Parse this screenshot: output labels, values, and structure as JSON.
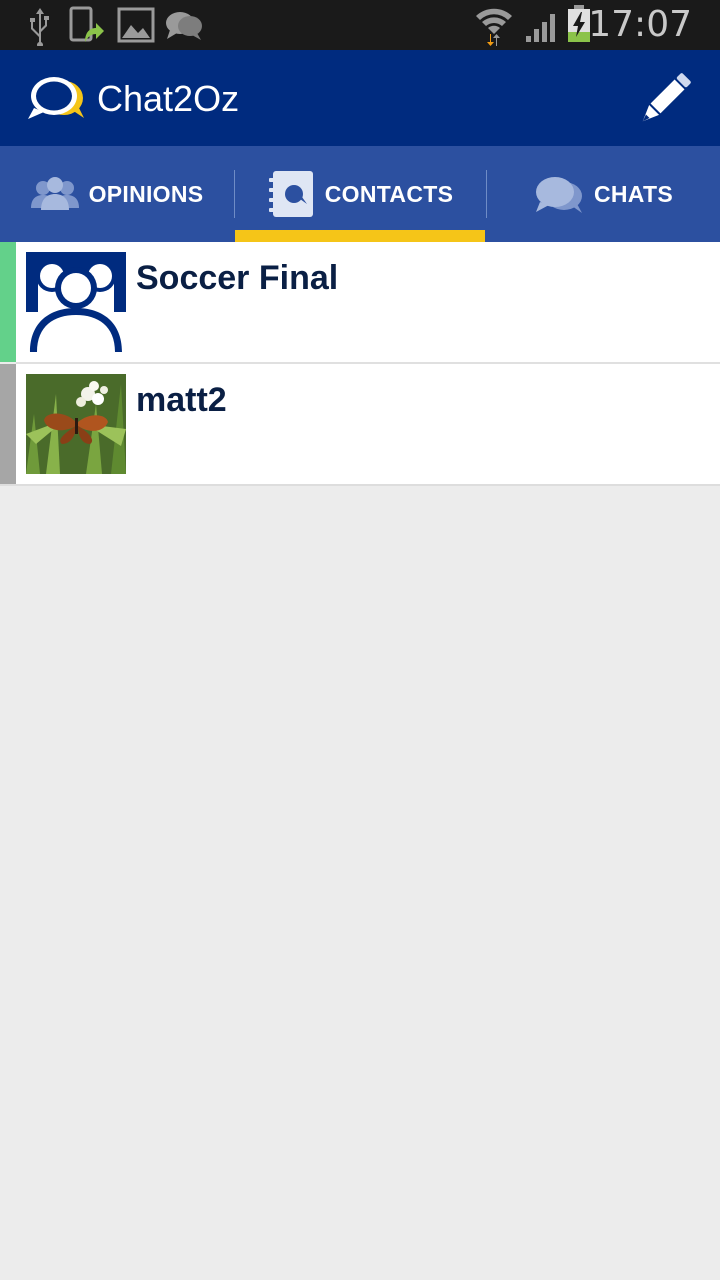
{
  "status_bar": {
    "time": "17:07",
    "icons": [
      "usb-icon",
      "phone-update-icon",
      "gallery-icon",
      "chat-notification-icon",
      "wifi-icon",
      "signal-icon",
      "battery-charging-icon"
    ],
    "battery_color": "#8bc34a"
  },
  "app_bar": {
    "title": "Chat2Oz",
    "logo_icon": "speech-bubbles-icon",
    "action_icon": "pencil-icon"
  },
  "tabs": [
    {
      "label": "OPINIONS",
      "icon": "people-icon",
      "selected": false
    },
    {
      "label": "CONTACTS",
      "icon": "contacts-book-icon",
      "selected": true
    },
    {
      "label": "CHATS",
      "icon": "chat-bubbles-icon",
      "selected": false
    }
  ],
  "contacts": [
    {
      "name": "Soccer Final",
      "avatar": "group-icon",
      "stripe_color": "#63d18a"
    },
    {
      "name": "matt2",
      "avatar": "butterfly-photo",
      "stripe_color": "#a6a6a6"
    }
  ],
  "colors": {
    "app_bar": "#002b7f",
    "tab_bar": "#2c50a0",
    "indicator": "#f5c518",
    "background": "#ececec"
  }
}
